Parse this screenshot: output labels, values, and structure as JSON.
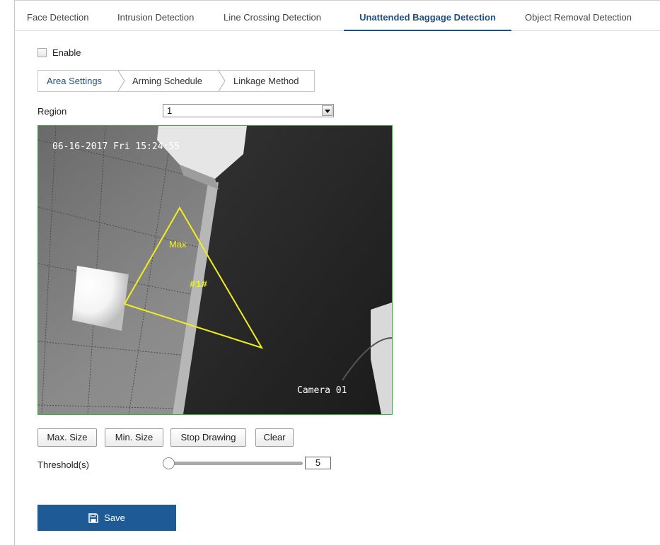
{
  "tabs": [
    {
      "label": "Face Detection",
      "active": false
    },
    {
      "label": "Intrusion Detection",
      "active": false
    },
    {
      "label": "Line Crossing Detection",
      "active": false
    },
    {
      "label": "Unattended Baggage Detection",
      "active": true
    },
    {
      "label": "Object Removal Detection",
      "active": false
    }
  ],
  "enable": {
    "label": "Enable",
    "checked": false
  },
  "subtabs": [
    {
      "label": "Area Settings",
      "active": true
    },
    {
      "label": "Arming Schedule",
      "active": false
    },
    {
      "label": "Linkage Method",
      "active": false
    }
  ],
  "region": {
    "label": "Region",
    "value": "1"
  },
  "video": {
    "timestamp": "06-16-2017 Fri 15:24:55",
    "camera_name": "Camera 01",
    "region_label": "Max",
    "region_id": "#1#"
  },
  "buttons": {
    "max_size": "Max. Size",
    "min_size": "Min. Size",
    "stop_drawing": "Stop Drawing",
    "clear": "Clear"
  },
  "threshold": {
    "label": "Threshold(s)",
    "value": "5"
  },
  "save": {
    "label": "Save",
    "icon": "save-icon"
  },
  "colors": {
    "accent": "#1d5a96",
    "active_tab": "#21507e",
    "region_outline": "#f2ee1d",
    "video_border": "#38b53b"
  }
}
